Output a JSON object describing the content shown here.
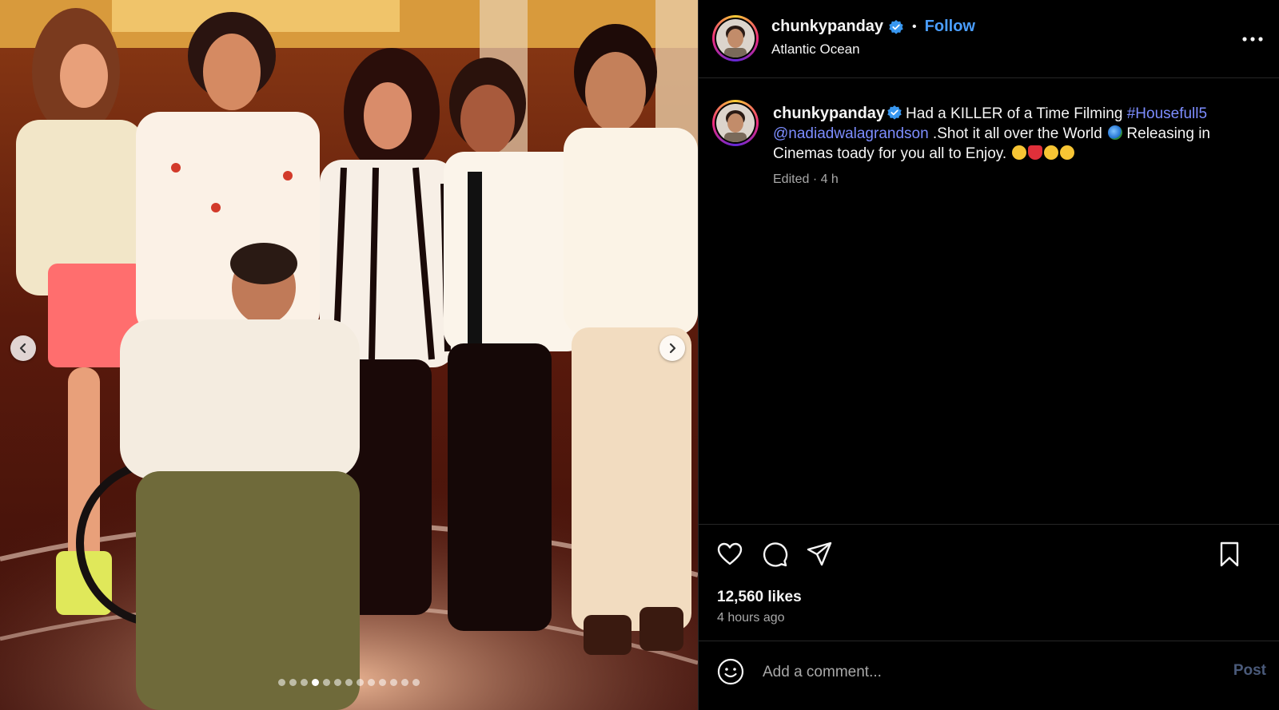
{
  "post": {
    "author": "chunkypanday",
    "follow_label": "Follow",
    "separator": "•",
    "location": "Atlantic Ocean",
    "caption": {
      "text_1": "Had a KILLER of a Time Filming ",
      "hashtag": "#Housefull5",
      "mention": "@nadiadwalagrandson",
      "text_2": " .Shot it all over the World ",
      "text_3": " Releasing in Cinemas toady for you all to Enjoy. "
    },
    "meta": "Edited · 4 h",
    "likes": "12,560 likes",
    "time_ago": "4 hours ago"
  },
  "carousel": {
    "slide_count": 13,
    "active_index": 3
  },
  "comment": {
    "placeholder": "Add a comment...",
    "post_label": "Post"
  },
  "icons": {
    "verified": "verified-badge-icon",
    "more": "more-options-icon",
    "like": "heart-icon",
    "comment": "comment-icon",
    "share": "share-icon",
    "save": "bookmark-icon",
    "emoji": "smiley-icon",
    "prev": "chevron-left-icon",
    "next": "chevron-right-icon"
  },
  "colors": {
    "background": "#000000",
    "link": "#7d8dff",
    "follow": "#4a9eff",
    "verified": "#3897f0",
    "muted": "#a8a8a8"
  }
}
